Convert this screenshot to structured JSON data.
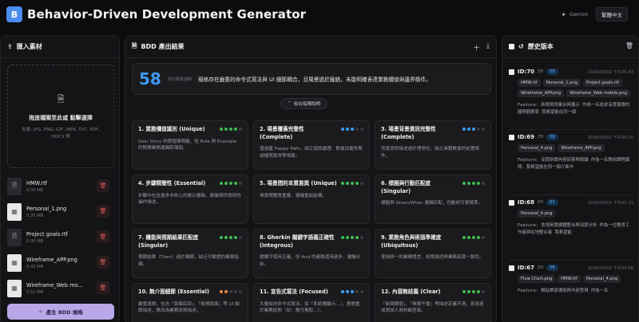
{
  "header": {
    "logo_letter": "B",
    "title": "Behavior-Driven Development Generator",
    "model": "Gemini",
    "language": "繁體中文"
  },
  "left": {
    "title": "匯入素材",
    "dropzone_title": "拖放檔案至此或 點擊選擇",
    "dropzone_types": "支援: JPG, PNG, GIF, MP4, TXT, PDF, DOCX 等",
    "files": [
      {
        "name": "HMW.rtf",
        "size": "0.00 MB",
        "type": "doc"
      },
      {
        "name": "Personal_1.png",
        "size": "0.35 MB",
        "type": "img"
      },
      {
        "name": "Project goals.rtf",
        "size": "0.00 MB",
        "type": "doc"
      },
      {
        "name": "Wireframe_APP.png",
        "size": "0.43 MB",
        "type": "img"
      },
      {
        "name": "Wireframe_Web mo...",
        "size": "0.51 MB",
        "type": "img"
      }
    ],
    "generate_label": "產生 BDD 規格"
  },
  "mid": {
    "title": "BDD 產出結果",
    "score": "58",
    "score_label": "評分標準說明",
    "summary": "規格存在嚴重的命令式寫法與 UI 細節耦合，且場景過於龐統，未能明確表達業務價值與邊界條件。",
    "collapse_label": "收合指標說明",
    "cards": [
      {
        "title": "1. 業務價值識別 (Unique)",
        "desc": "User Story 的價值陳明確，但 Rule 與 Example 的對應業務邏輯較薄弱。",
        "level": 4,
        "color": "#3fb950"
      },
      {
        "title": "2. 場景覆蓋完整性 (Complete)",
        "desc": "僅涵蓋 Happy Path，缺乏錯誤處理、數據加載失敗或權限異常等場景。",
        "level": 3,
        "color": "#3d9bf5"
      },
      {
        "title": "3. 場景背景資訊完整性 (Complete)",
        "desc": "背景資訊描述過於理想化，缺乏具體數據的前置條件。",
        "level": 3,
        "color": "#3d9bf5"
      },
      {
        "title": "4. 步驟精簡性 (Essential)",
        "desc": "步驟中包含過多非核心的展示邏輯，建議移除瑣碎的操作描述。",
        "level": 4,
        "color": "#3fb950"
      },
      {
        "title": "5. 場景間的本質差異 (Unique)",
        "desc": "場景間實質重疊，建議重組結構。",
        "level": 4,
        "color": "#3fb950"
      },
      {
        "title": "6. 標題與行動匹配度 (Singular)",
        "desc": "標題與 Given/When 邏輯匹配，但動詞可更精準。",
        "level": 4,
        "color": "#3fb950"
      },
      {
        "title": "7. 機能與預期結果匹配度 (Singular)",
        "desc": "預期結果（Then）過於模糊，缺乏可驗證的業務指標。",
        "level": 4,
        "color": "#3fb950"
      },
      {
        "title": "8. Gherkin 關鍵字語義正確性 (Integrous)",
        "desc": "關鍵字使用正確，但 And 的連鎖運用過多，建議分拆。",
        "level": 4,
        "color": "#3fb950"
      },
      {
        "title": "9. 業務角色與術語準確度 (Ubiquitous)",
        "desc": "使用統一的業務語言，術語描述與業務高度一致性。",
        "level": 4,
        "color": "#3fb950"
      },
      {
        "title": "10. 無介面細節 (Essential)",
        "desc": "嚴重違規，包含「頁面底部」、「檢視頁面」等 UI 細節描述，應改為業務狀態描述。",
        "level": 2,
        "color": "#f0883e"
      },
      {
        "title": "11. 宣告式寫法 (Focused)",
        "desc": "大量採用命令式寫法，如「系統應顯示...」，應側重於業務狀態（如：應可看取...）。",
        "level": 3,
        "color": "#3d9bf5"
      },
      {
        "title": "12. 內容無歧義 (Clear)",
        "desc": "「新聞價值」、「無關干擾」等描述定義不清，容易造成測試人員判斷差異。",
        "level": 4,
        "color": "#3fb950"
      }
    ]
  },
  "right": {
    "title": "歷史版本",
    "items": [
      {
        "id": "ID:70",
        "lang": "ZH",
        "score": "58",
        "date": "2026/05/02 下午06:43",
        "tags": [
          "HMW.rtf",
          "Personal_1.png",
          "Project goals.rtf",
          "Wireframe_APP.png",
          "Wireframe_Web mobile.png"
        ],
        "feature": "Feature: 新聞資訊聚合與展示 作為一名追求深度報導的國際觀察家 我希望能在同一個"
      },
      {
        "id": "ID:69",
        "lang": "ZH",
        "score": "58",
        "date": "2026/05/02 下午05:20",
        "tags": [
          "Personal_4.png",
          "Wireframe_APP.png"
        ],
        "feature": "Feature: 深度新聞內容探索與閱讀 作為一名教研課程顧問，我希望能在同一個介面中"
      },
      {
        "id": "ID:68",
        "lang": "ZH",
        "score": "63",
        "date": "2026/05/02 下午05:11",
        "tags": [
          "Personal_4.png"
        ],
        "feature": "Feature: 本地英語媒體整合與深度分析 作為一位教育工作者與在地整合者 我希望能"
      },
      {
        "id": "ID:67",
        "lang": "ZH",
        "score": "58",
        "date": "2026/05/02 下午05:08",
        "tags": [
          "Flow Chart.png",
          "HMW.rtf",
          "Personal_4.png"
        ],
        "feature": "Feature: 網站首頁導航與內容發現 作為一名"
      }
    ]
  },
  "icons": {
    "upload": "upload-icon",
    "file": "file-icon",
    "trash": "trash-icon",
    "history": "history-icon",
    "sparkle": "sparkle-icon",
    "plus": "plus-icon",
    "download": "download-icon",
    "chevron": "chevron-up-icon"
  },
  "colors": {
    "accent": "#3d9bf5",
    "brand": "#4a8cf0",
    "generate_button": "#b9a7e8",
    "danger": "#d45b5b",
    "good": "#3fb950",
    "warn": "#f0883e"
  }
}
